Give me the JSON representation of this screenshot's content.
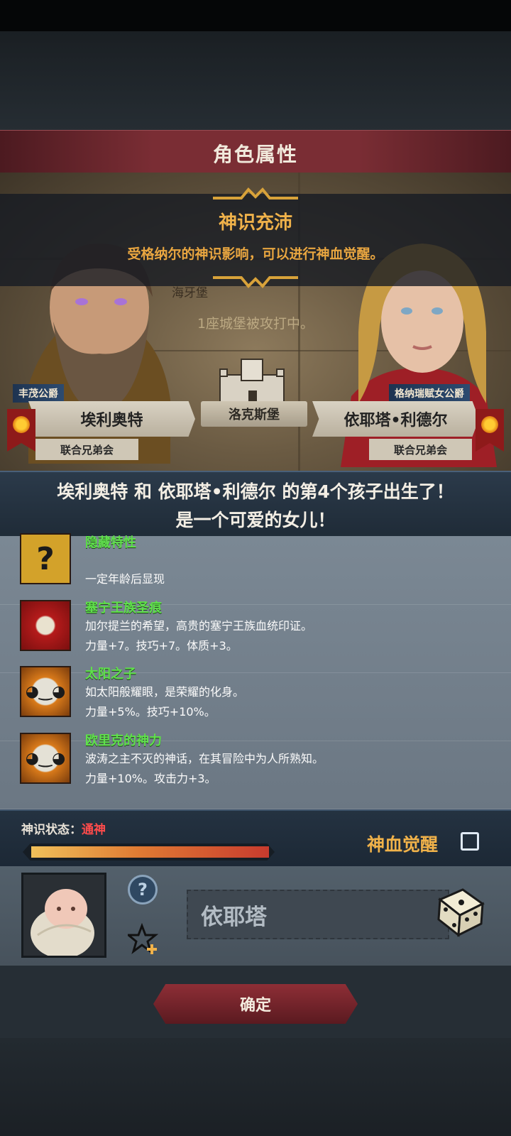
{
  "header": {
    "title": "角色属性"
  },
  "banner": {
    "title": "神识充沛",
    "description": "受格纳尔的神识影响，可以进行神血觉醒。"
  },
  "map": {
    "castle_label_top": "海牙堡",
    "siege_text": "1座城堡被攻打中。",
    "location": "洛克斯堡"
  },
  "father": {
    "title": "丰茂公爵",
    "name": "埃利奥特",
    "faction": "联合兄弟会"
  },
  "mother": {
    "title": "格纳瑞赋女公爵",
    "name": "依耶塔•利德尔",
    "faction": "联合兄弟会"
  },
  "announcement": {
    "line1": "埃利奥特 和 依耶塔•利德尔 的第4个孩子出生了！",
    "line2": "是一个可爱的女儿！"
  },
  "traits": [
    {
      "name": "隐藏特性",
      "line1": "",
      "line2": "一定年龄后显现",
      "icon": "question-icon"
    },
    {
      "name": "塞宁王族圣痕",
      "line1": "加尔提兰的希望，高贵的塞宁王族血统印证。",
      "line2": "力量+7。技巧+7。体质+3。",
      "icon": "holy-mark-icon"
    },
    {
      "name": "太阳之子",
      "line1": "如太阳般耀眼，是荣耀的化身。",
      "line2": "力量+5%。技巧+10%。",
      "icon": "sun-face-icon"
    },
    {
      "name": "欧里克的神力",
      "line1": "波涛之主不灭的神话，在其冒险中为人所熟知。",
      "line2": "力量+10%。攻击力+3。",
      "icon": "sun-face-icon"
    }
  ],
  "state": {
    "label": "神识状态：",
    "value": "通神",
    "progress": 1.0,
    "awaken_label": "神血觉醒",
    "awaken_checked": false
  },
  "child": {
    "name": "依耶塔"
  },
  "confirm_label": "确定",
  "colors": {
    "accent": "#f0b24a",
    "trait_name": "#5fe04b",
    "header": "#7a2d34"
  }
}
